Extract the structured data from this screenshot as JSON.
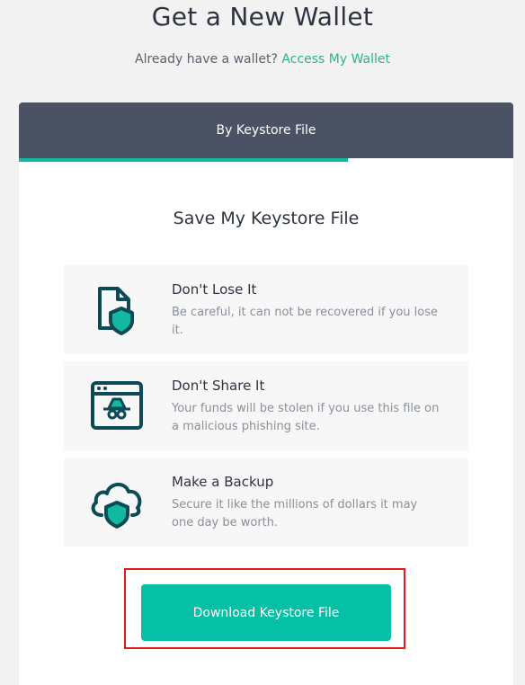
{
  "header": {
    "title": "Get a New Wallet",
    "subtitle_text": "Already have a wallet?",
    "subtitle_link": "Access My Wallet"
  },
  "tabs": [
    {
      "label": "By Keystore File",
      "active": true
    }
  ],
  "content": {
    "section_title": "Save My Keystore File",
    "items": [
      {
        "title": "Don't Lose It",
        "description": "Be careful, it can not be recovered if you lose it.",
        "icon": "file-shield-icon"
      },
      {
        "title": "Don't Share It",
        "description": "Your funds will be stolen if you use this file on a malicious phishing site.",
        "icon": "browser-spy-icon"
      },
      {
        "title": "Make a Backup",
        "description": "Secure it like the millions of dollars it may one day be worth.",
        "icon": "cloud-shield-icon"
      }
    ],
    "download_button": "Download Keystore File"
  },
  "colors": {
    "accent": "#05c0a5",
    "link": "#2bb58f",
    "header_bg": "#4a5264",
    "icon": "#0c4a55",
    "highlight": "#e21a1a"
  }
}
